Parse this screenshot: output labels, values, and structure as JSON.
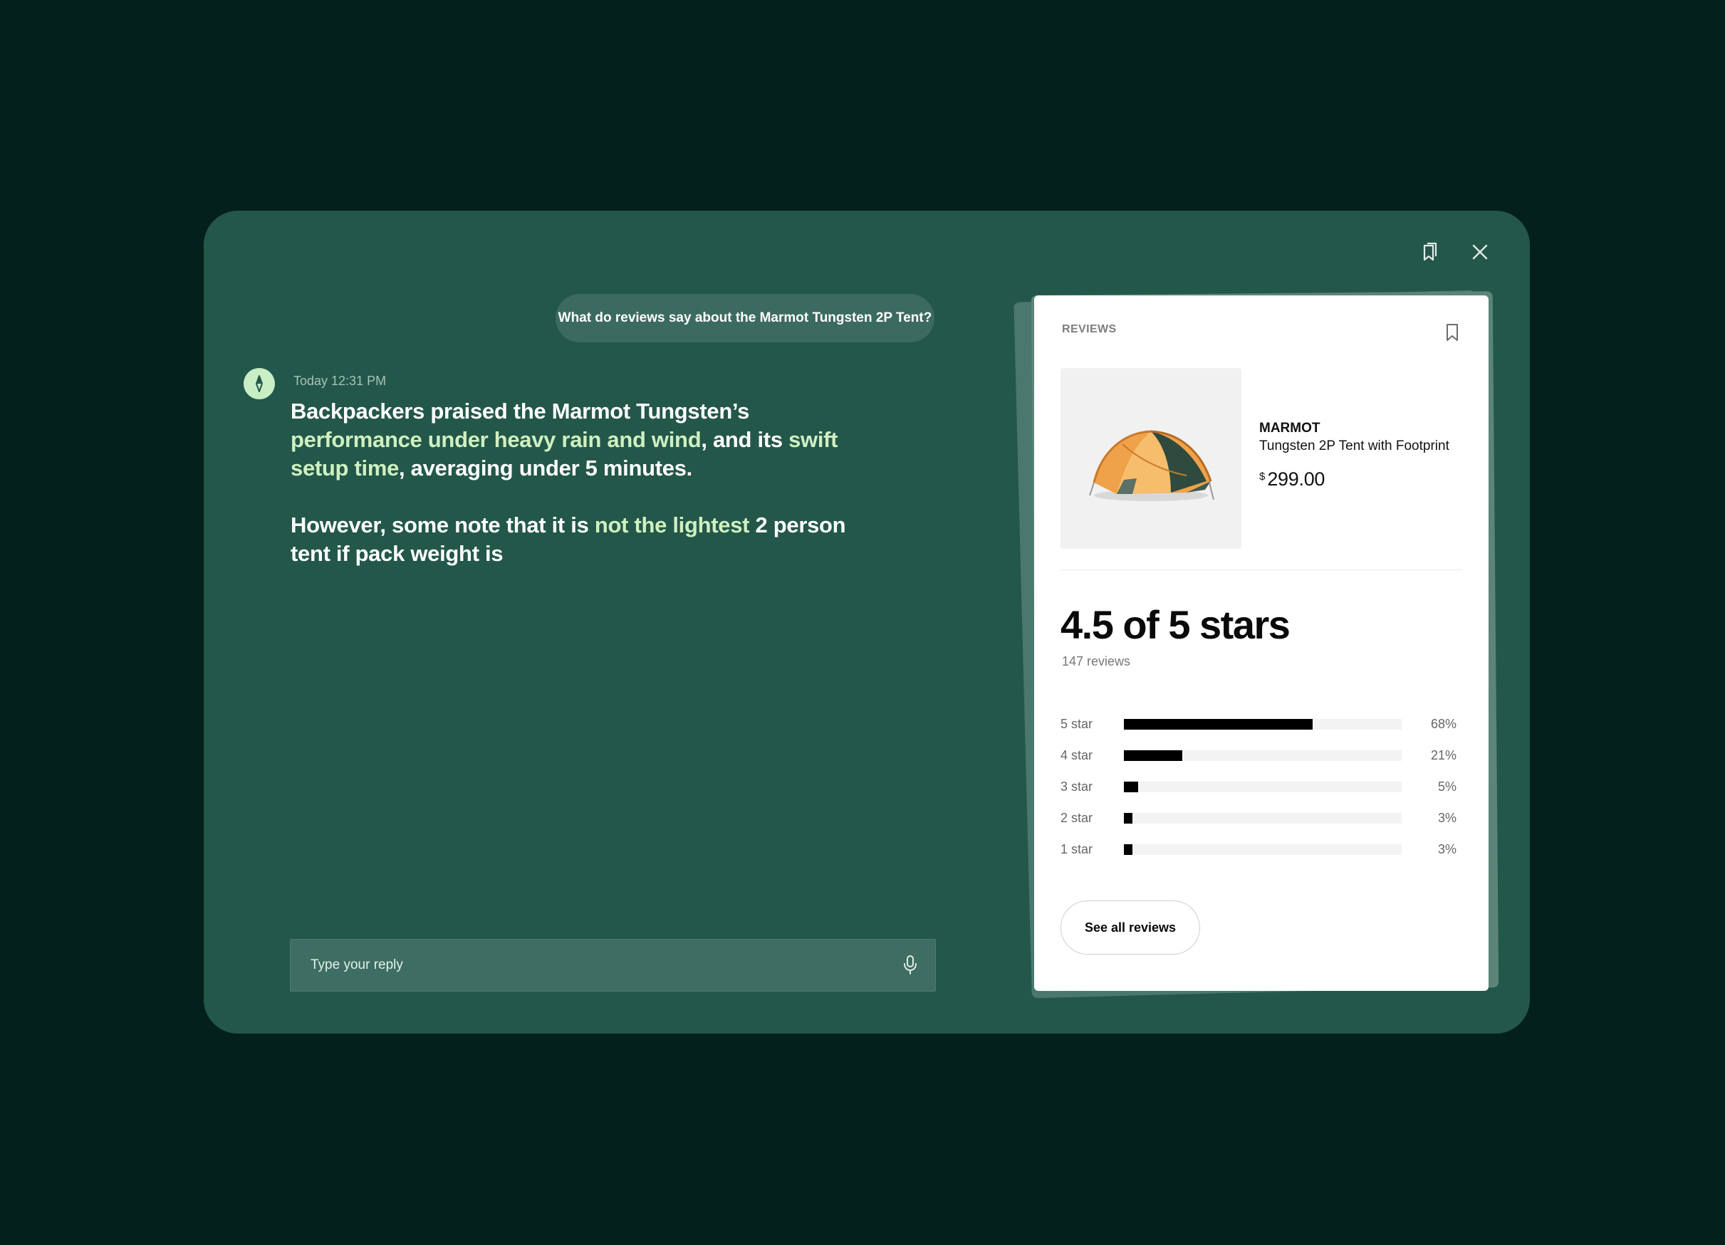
{
  "conversation": {
    "user_message": "What do reviews say about the Marmot Tungsten 2P Tent?",
    "timestamp": "Today 12:31 PM",
    "assistant_paragraphs": [
      [
        {
          "text": "Backpackers praised the Marmot Tungsten’s ",
          "highlight": false
        },
        {
          "text": "performance under heavy rain and wind",
          "highlight": true
        },
        {
          "text": ", and its ",
          "highlight": false
        },
        {
          "text": "swift setup time",
          "highlight": true
        },
        {
          "text": ", averaging under 5 minutes.",
          "highlight": false
        }
      ],
      [
        {
          "text": "However, some note that it is ",
          "highlight": false
        },
        {
          "text": "not the lightest",
          "highlight": true
        },
        {
          "text": " 2 person tent if pack weight is",
          "highlight": false
        }
      ]
    ]
  },
  "reply": {
    "placeholder": "Type your reply",
    "value": ""
  },
  "icons": {
    "bookmarks": "bookmarks-icon",
    "close": "close-icon",
    "avatar": "compass-icon",
    "mic": "microphone-icon",
    "card_bookmark": "bookmark-icon",
    "product": "tent-image"
  },
  "card": {
    "label": "REVIEWS",
    "brand": "MARMOT",
    "product_name": "Tungsten 2P Tent with Footprint",
    "price_currency": "$",
    "price_value": "299.00",
    "rating_headline": "4.5 of 5 stars",
    "review_count": "147 reviews",
    "distribution": [
      {
        "label": "5 star",
        "pct": "68%",
        "value": 68
      },
      {
        "label": "4 star",
        "pct": "21%",
        "value": 21
      },
      {
        "label": "3 star",
        "pct": "5%",
        "value": 5
      },
      {
        "label": "2 star",
        "pct": "3%",
        "value": 3
      },
      {
        "label": "1 star",
        "pct": "3%",
        "value": 3
      }
    ],
    "see_all_label": "See all reviews"
  },
  "colors": {
    "background": "#03211a",
    "panel": "#23574a",
    "highlight_text": "#cff0c0",
    "avatar": "#c9eec5",
    "bar_fill": "#000000"
  }
}
